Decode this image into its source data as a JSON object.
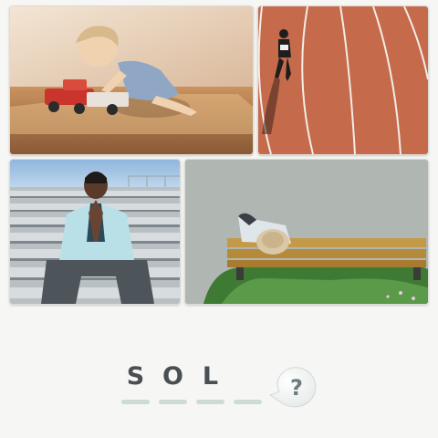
{
  "puzzle": {
    "letters": [
      "S",
      "O",
      "L",
      ""
    ],
    "photos": [
      {
        "name": "toddler-with-toy-truck"
      },
      {
        "name": "runner-on-track"
      },
      {
        "name": "man-on-bleachers"
      },
      {
        "name": "man-on-bench"
      }
    ]
  },
  "hint": {
    "label": "?"
  },
  "colors": {
    "background": "#f6f6f4",
    "letter": "#4a4f52",
    "slot_line": "#cddad6",
    "track": "#c66a4c"
  }
}
